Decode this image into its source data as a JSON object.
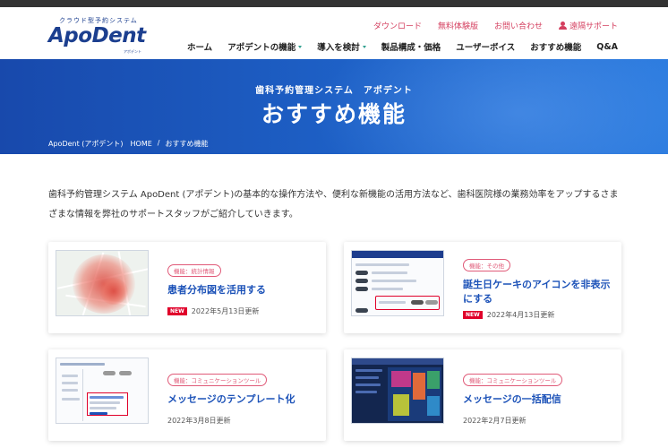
{
  "header": {
    "logo_tagline": "クラウド型予約システム",
    "logo_name": "ApoDent",
    "logo_sub": "アポデント",
    "utility": [
      "ダウンロード",
      "無料体験版",
      "お問い合わせ",
      "遠隔サポート"
    ],
    "nav": [
      {
        "label": "ホーム",
        "caret": false
      },
      {
        "label": "アポデントの機能",
        "caret": true
      },
      {
        "label": "導入を検討",
        "caret": true
      },
      {
        "label": "製品構成・価格",
        "caret": false
      },
      {
        "label": "ユーザーボイス",
        "caret": false
      },
      {
        "label": "おすすめ機能",
        "caret": false
      },
      {
        "label": "Q&A",
        "caret": false
      }
    ]
  },
  "hero": {
    "subtitle": "歯科予約管理システム　アポデント",
    "title": "おすすめ機能",
    "breadcrumb": [
      "ApoDent (アポデント)　HOME",
      "/",
      "おすすめ機能"
    ]
  },
  "intro": "歯科予約管理システム ApoDent (アポデント)の基本的な操作方法や、便利な新機能の活用方法など、歯科医院様の業務効率をアップするさまざまな情報を弊社のサポートスタッフがご紹介していきます。",
  "cards": [
    {
      "category": "機能：統計情報",
      "title": "患者分布図を活用する",
      "new": true,
      "new_label": "NEW",
      "date": "2022年5月13日更新"
    },
    {
      "category": "機能：その他",
      "title": "誕生日ケーキのアイコンを非表示にする",
      "new": true,
      "new_label": "NEW",
      "date": "2022年4月13日更新"
    },
    {
      "category": "機能：コミュニケーションツール",
      "title": "メッセージのテンプレート化",
      "new": false,
      "new_label": "",
      "date": "2022年3月8日更新"
    },
    {
      "category": "機能：コミュニケーションツール",
      "title": "メッセージの一括配信",
      "new": false,
      "new_label": "",
      "date": "2022年2月7日更新"
    }
  ],
  "colors": {
    "brand_blue": "#1c3f8f",
    "accent_pink": "#d43f5f",
    "hero_blue": "#1e62c8",
    "link_blue": "#1c52b8",
    "new_red": "#e0002a"
  }
}
